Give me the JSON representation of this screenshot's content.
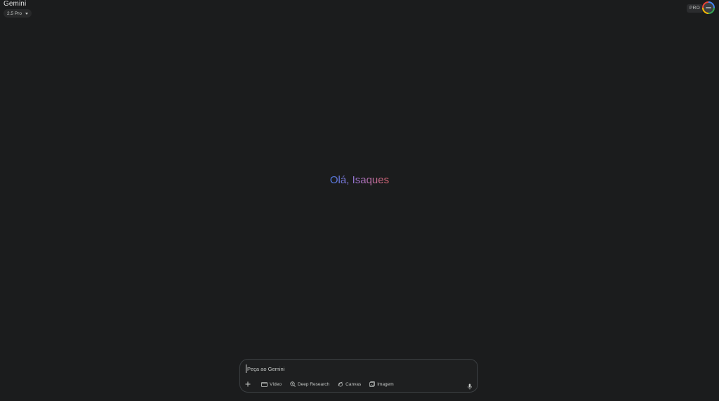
{
  "header": {
    "app_title": "Gemini",
    "model_label": "2.5 Pro"
  },
  "top_right": {
    "plan_badge": "PRO"
  },
  "greeting": {
    "text": "Olá, Isaques"
  },
  "composer": {
    "placeholder": "Peça ao Gemini",
    "tools": {
      "video": "Vídeo",
      "deep_research": "Deep Research",
      "canvas": "Canvas",
      "image": "Imagem"
    }
  },
  "colors": {
    "background": "#1b1c1d",
    "greeting_gradient_start": "#4f7de8",
    "greeting_gradient_end": "#d96570"
  },
  "icons": [
    "chevron-down-icon",
    "plus-icon",
    "video-icon",
    "deep-research-icon",
    "canvas-icon",
    "image-icon",
    "mic-icon"
  ]
}
